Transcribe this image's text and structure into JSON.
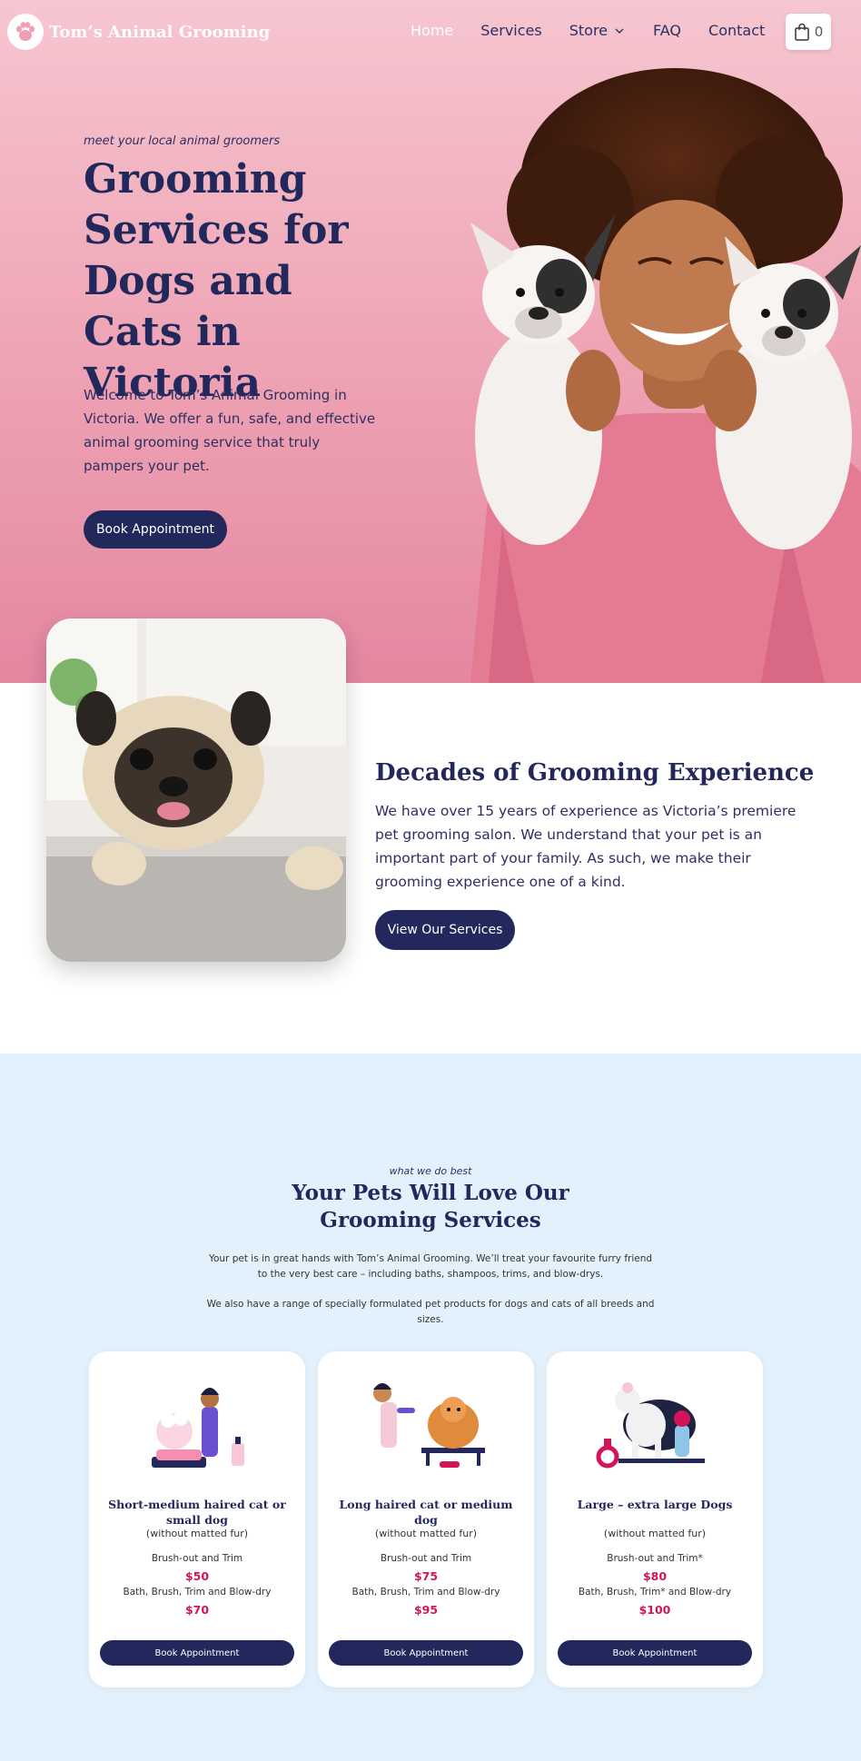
{
  "brand": {
    "name": "Tom’s Animal Grooming"
  },
  "nav": {
    "items": [
      {
        "label": "Home",
        "active": true
      },
      {
        "label": "Services"
      },
      {
        "label": "Store",
        "has_dropdown": true
      },
      {
        "label": "FAQ"
      },
      {
        "label": "Contact"
      }
    ],
    "cart_count": "0"
  },
  "hero": {
    "kicker": "meet your local animal groomers",
    "title": "Grooming Services for Dogs and Cats in Victoria",
    "description": "Welcome to Tom’s Animal Grooming in Victoria. We offer a fun, safe, and effective animal grooming service that truly pampers your pet.",
    "button": "Book Appointment"
  },
  "experience": {
    "title": "Decades of Grooming Experience",
    "description": "We have over 15 years of experience as Victoria’s premiere pet grooming salon. We understand that your pet is an important part of your family. As such, we make their grooming experience one of a kind.",
    "button": "View Our Services"
  },
  "services": {
    "kicker": "what we do best",
    "title": "Your Pets Will Love Our Grooming Services",
    "description_1": "Your pet is in great hands with Tom’s Animal Grooming. We’ll treat your favourite furry friend to the very best care – including baths, shampoos, trims, and blow-drys.",
    "description_2": "We also have a range of specially formulated pet products for dogs and cats of all breeds and sizes.",
    "cards": [
      {
        "title": "Short-medium haired cat or small dog",
        "note": "(without matted fur)",
        "service_1": "Brush-out and Trim",
        "price_1": "$50",
        "service_2": "Bath, Brush, Trim and Blow-dry",
        "price_2": "$70",
        "button": "Book Appointment"
      },
      {
        "title": "Long haired cat or medium dog",
        "note": "(without matted fur)",
        "service_1": "Brush-out and Trim",
        "price_1": "$75",
        "service_2": "Bath, Brush, Trim and Blow-dry",
        "price_2": "$95",
        "button": "Book Appointment"
      },
      {
        "title": "Large – extra large Dogs",
        "note": "(without matted fur)",
        "service_1": "Brush-out and Trim*",
        "price_1": "$80",
        "service_2": "Bath, Brush, Trim* and Blow-dry",
        "price_2": "$100",
        "button": "Book Appointment"
      }
    ]
  },
  "colors": {
    "navy": "#23285c",
    "pink": "#eea2b3",
    "price": "#d4145a",
    "light_blue": "#e3f1fc"
  },
  "icons": [
    "paw-logo-icon",
    "chevron-down-icon",
    "shopping-bag-icon"
  ]
}
